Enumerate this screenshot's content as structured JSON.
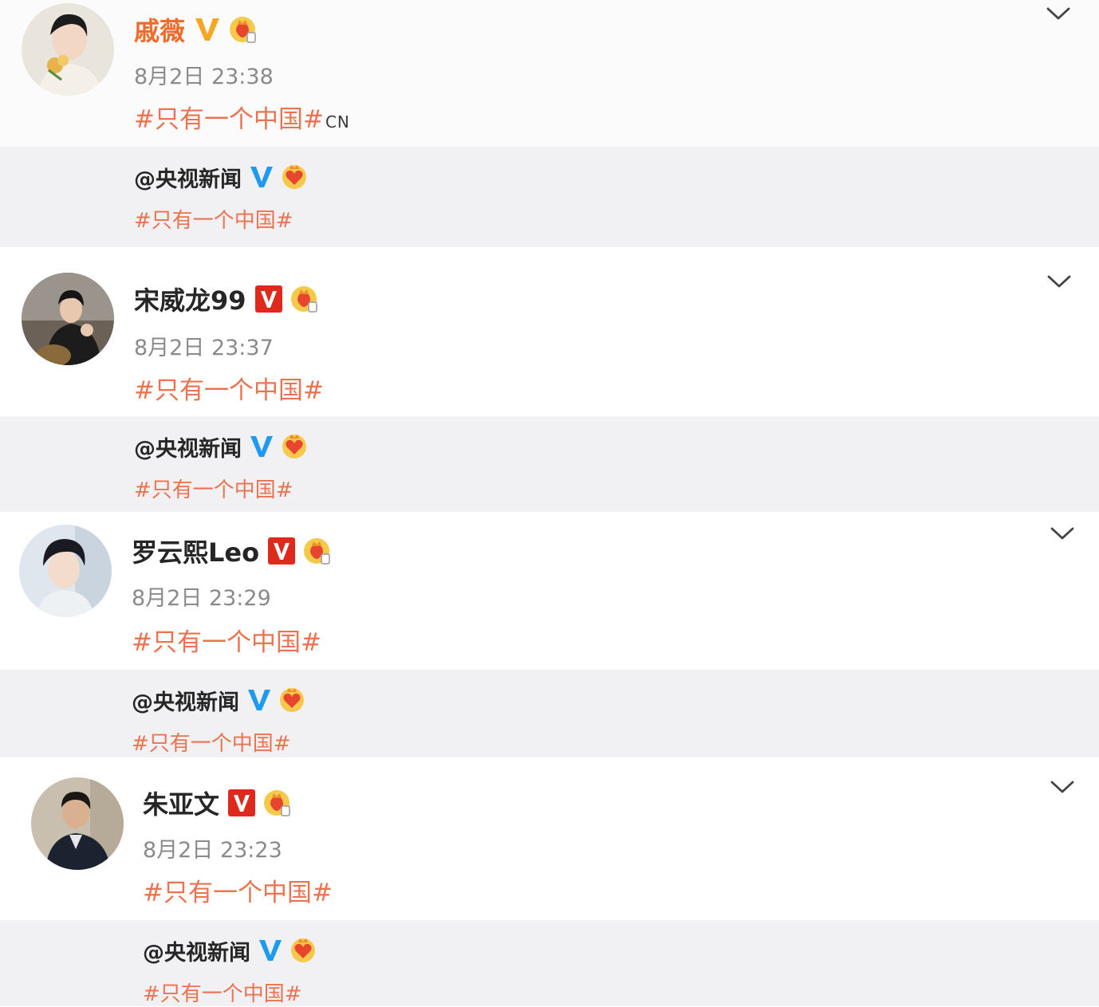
{
  "colors": {
    "hashtag": "#eb7350",
    "name_vip": "#f06a2a",
    "verified_orange": "#f5a623",
    "verified_red": "#e0291d",
    "verified_blue": "#1e9bf0"
  },
  "posts": [
    {
      "username": "戚薇",
      "verified_icon": "gold-v-icon",
      "medal_icon": "fan-medal-icon",
      "time": "8月2日 23:38",
      "hashtag": "#只有一个中国#",
      "hashtag_suffix": "CN",
      "quote": {
        "author": "@央视新闻",
        "verified_icon": "blue-v-icon",
        "medal_icon": "heart-medal-icon",
        "hashtag": "#只有一个中国#"
      }
    },
    {
      "username": "宋威龙99",
      "verified_icon": "red-v-icon",
      "medal_icon": "fan-medal-icon",
      "time": "8月2日 23:37",
      "hashtag": "#只有一个中国#",
      "quote": {
        "author": "@央视新闻",
        "verified_icon": "blue-v-icon",
        "medal_icon": "heart-medal-icon",
        "hashtag": "#只有一个中国#"
      }
    },
    {
      "username": "罗云熙Leo",
      "verified_icon": "red-v-icon",
      "medal_icon": "fan-medal-icon",
      "time": "8月2日 23:29",
      "hashtag": "#只有一个中国#",
      "quote": {
        "author": "@央视新闻",
        "verified_icon": "blue-v-icon",
        "medal_icon": "heart-medal-icon",
        "hashtag": "#只有一个中国#"
      }
    },
    {
      "username": "朱亚文",
      "verified_icon": "red-v-icon",
      "medal_icon": "fan-medal-icon",
      "time": "8月2日 23:23",
      "hashtag": "#只有一个中国#",
      "quote": {
        "author": "@央视新闻",
        "verified_icon": "blue-v-icon",
        "medal_icon": "heart-medal-icon",
        "hashtag": "#只有一个中国#"
      }
    }
  ]
}
